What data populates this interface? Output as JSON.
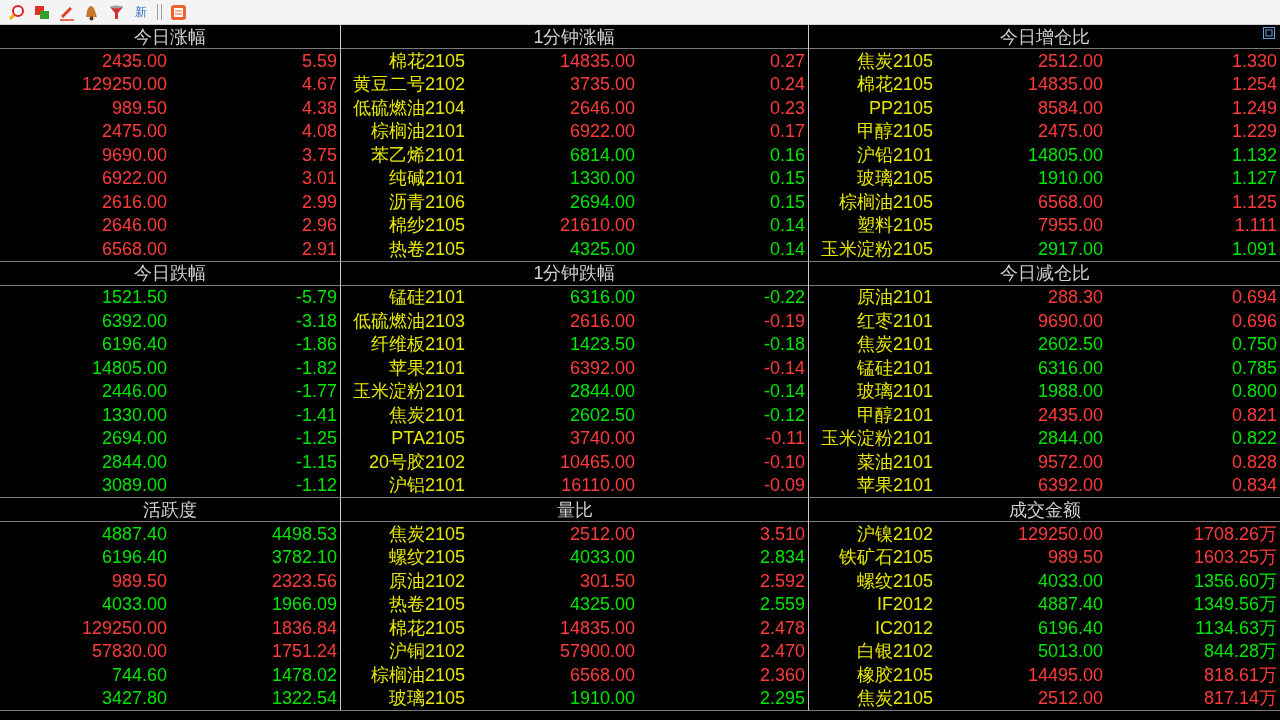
{
  "toolbar": {
    "new_label": "新"
  },
  "panels": [
    {
      "title": "今日涨幅",
      "rows": [
        {
          "price": "2435.00",
          "price_rising": true,
          "value": "5.59",
          "value_rising": true
        },
        {
          "price": "129250.00",
          "price_rising": true,
          "value": "4.67",
          "value_rising": true
        },
        {
          "price": "989.50",
          "price_rising": true,
          "value": "4.38",
          "value_rising": true
        },
        {
          "price": "2475.00",
          "price_rising": true,
          "value": "4.08",
          "value_rising": true
        },
        {
          "price": "9690.00",
          "price_rising": true,
          "value": "3.75",
          "value_rising": true
        },
        {
          "price": "6922.00",
          "price_rising": true,
          "value": "3.01",
          "value_rising": true
        },
        {
          "price": "2616.00",
          "price_rising": true,
          "value": "2.99",
          "value_rising": true
        },
        {
          "price": "2646.00",
          "price_rising": true,
          "value": "2.96",
          "value_rising": true
        },
        {
          "price": "6568.00",
          "price_rising": true,
          "value": "2.91",
          "value_rising": true
        }
      ]
    },
    {
      "title": "1分钟涨幅",
      "rows": [
        {
          "name": "棉花2105",
          "price": "14835.00",
          "price_rising": true,
          "value": "0.27",
          "value_rising": true
        },
        {
          "name": "黄豆二号2102",
          "price": "3735.00",
          "price_rising": true,
          "value": "0.24",
          "value_rising": true
        },
        {
          "name": "低硫燃油2104",
          "price": "2646.00",
          "price_rising": true,
          "value": "0.23",
          "value_rising": true
        },
        {
          "name": "棕榈油2101",
          "price": "6922.00",
          "price_rising": true,
          "value": "0.17",
          "value_rising": true
        },
        {
          "name": "苯乙烯2101",
          "price": "6814.00",
          "price_rising": false,
          "value": "0.16",
          "value_rising": false
        },
        {
          "name": "纯碱2101",
          "price": "1330.00",
          "price_rising": false,
          "value": "0.15",
          "value_rising": false
        },
        {
          "name": "沥青2106",
          "price": "2694.00",
          "price_rising": false,
          "value": "0.15",
          "value_rising": false
        },
        {
          "name": "棉纱2105",
          "price": "21610.00",
          "price_rising": true,
          "value": "0.14",
          "value_rising": false
        },
        {
          "name": "热卷2105",
          "price": "4325.00",
          "price_rising": false,
          "value": "0.14",
          "value_rising": false
        }
      ]
    },
    {
      "title": "今日增仓比",
      "rows": [
        {
          "name": "焦炭2105",
          "price": "2512.00",
          "price_rising": true,
          "value": "1.330",
          "value_rising": true
        },
        {
          "name": "棉花2105",
          "price": "14835.00",
          "price_rising": true,
          "value": "1.254",
          "value_rising": true
        },
        {
          "name": "PP2105",
          "price": "8584.00",
          "price_rising": true,
          "value": "1.249",
          "value_rising": true
        },
        {
          "name": "甲醇2105",
          "price": "2475.00",
          "price_rising": true,
          "value": "1.229",
          "value_rising": true
        },
        {
          "name": "沪铅2101",
          "price": "14805.00",
          "price_rising": false,
          "value": "1.132",
          "value_rising": false
        },
        {
          "name": "玻璃2105",
          "price": "1910.00",
          "price_rising": false,
          "value": "1.127",
          "value_rising": false
        },
        {
          "name": "棕榈油2105",
          "price": "6568.00",
          "price_rising": true,
          "value": "1.125",
          "value_rising": true
        },
        {
          "name": "塑料2105",
          "price": "7955.00",
          "price_rising": true,
          "value": "1.111",
          "value_rising": true
        },
        {
          "name": "玉米淀粉2105",
          "price": "2917.00",
          "price_rising": false,
          "value": "1.091",
          "value_rising": false
        }
      ]
    },
    {
      "title": "今日跌幅",
      "rows": [
        {
          "price": "1521.50",
          "price_rising": false,
          "value": "-5.79",
          "value_rising": false
        },
        {
          "price": "6392.00",
          "price_rising": false,
          "value": "-3.18",
          "value_rising": false
        },
        {
          "price": "6196.40",
          "price_rising": false,
          "value": "-1.86",
          "value_rising": false
        },
        {
          "price": "14805.00",
          "price_rising": false,
          "value": "-1.82",
          "value_rising": false
        },
        {
          "price": "2446.00",
          "price_rising": false,
          "value": "-1.77",
          "value_rising": false
        },
        {
          "price": "1330.00",
          "price_rising": false,
          "value": "-1.41",
          "value_rising": false
        },
        {
          "price": "2694.00",
          "price_rising": false,
          "value": "-1.25",
          "value_rising": false
        },
        {
          "price": "2844.00",
          "price_rising": false,
          "value": "-1.15",
          "value_rising": false
        },
        {
          "price": "3089.00",
          "price_rising": false,
          "value": "-1.12",
          "value_rising": false
        }
      ]
    },
    {
      "title": "1分钟跌幅",
      "rows": [
        {
          "name": "锰硅2101",
          "price": "6316.00",
          "price_rising": false,
          "value": "-0.22",
          "value_rising": false
        },
        {
          "name": "低硫燃油2103",
          "price": "2616.00",
          "price_rising": true,
          "value": "-0.19",
          "value_rising": true
        },
        {
          "name": "纤维板2101",
          "price": "1423.50",
          "price_rising": false,
          "value": "-0.18",
          "value_rising": false
        },
        {
          "name": "苹果2101",
          "price": "6392.00",
          "price_rising": true,
          "value": "-0.14",
          "value_rising": true
        },
        {
          "name": "玉米淀粉2101",
          "price": "2844.00",
          "price_rising": false,
          "value": "-0.14",
          "value_rising": false
        },
        {
          "name": "焦炭2101",
          "price": "2602.50",
          "price_rising": false,
          "value": "-0.12",
          "value_rising": false
        },
        {
          "name": "PTA2105",
          "price": "3740.00",
          "price_rising": true,
          "value": "-0.11",
          "value_rising": true
        },
        {
          "name": "20号胶2102",
          "price": "10465.00",
          "price_rising": true,
          "value": "-0.10",
          "value_rising": true
        },
        {
          "name": "沪铝2101",
          "price": "16110.00",
          "price_rising": true,
          "value": "-0.09",
          "value_rising": true
        }
      ]
    },
    {
      "title": "今日减仓比",
      "rows": [
        {
          "name": "原油2101",
          "price": "288.30",
          "price_rising": true,
          "value": "0.694",
          "value_rising": true
        },
        {
          "name": "红枣2101",
          "price": "9690.00",
          "price_rising": true,
          "value": "0.696",
          "value_rising": true
        },
        {
          "name": "焦炭2101",
          "price": "2602.50",
          "price_rising": false,
          "value": "0.750",
          "value_rising": false
        },
        {
          "name": "锰硅2101",
          "price": "6316.00",
          "price_rising": false,
          "value": "0.785",
          "value_rising": false
        },
        {
          "name": "玻璃2101",
          "price": "1988.00",
          "price_rising": false,
          "value": "0.800",
          "value_rising": false
        },
        {
          "name": "甲醇2101",
          "price": "2435.00",
          "price_rising": true,
          "value": "0.821",
          "value_rising": true
        },
        {
          "name": "玉米淀粉2101",
          "price": "2844.00",
          "price_rising": false,
          "value": "0.822",
          "value_rising": false
        },
        {
          "name": "菜油2101",
          "price": "9572.00",
          "price_rising": true,
          "value": "0.828",
          "value_rising": true
        },
        {
          "name": "苹果2101",
          "price": "6392.00",
          "price_rising": true,
          "value": "0.834",
          "value_rising": true
        }
      ]
    },
    {
      "title": "活跃度",
      "rows": [
        {
          "price": "4887.40",
          "price_rising": false,
          "value": "4498.53",
          "value_rising": false
        },
        {
          "price": "6196.40",
          "price_rising": false,
          "value": "3782.10",
          "value_rising": false
        },
        {
          "price": "989.50",
          "price_rising": true,
          "value": "2323.56",
          "value_rising": true
        },
        {
          "price": "4033.00",
          "price_rising": false,
          "value": "1966.09",
          "value_rising": false
        },
        {
          "price": "129250.00",
          "price_rising": true,
          "value": "1836.84",
          "value_rising": true
        },
        {
          "price": "57830.00",
          "price_rising": true,
          "value": "1751.24",
          "value_rising": true
        },
        {
          "price": "744.60",
          "price_rising": false,
          "value": "1478.02",
          "value_rising": false
        },
        {
          "price": "3427.80",
          "price_rising": false,
          "value": "1322.54",
          "value_rising": false
        }
      ]
    },
    {
      "title": "量比",
      "rows": [
        {
          "name": "焦炭2105",
          "price": "2512.00",
          "price_rising": true,
          "value": "3.510",
          "value_rising": true
        },
        {
          "name": "螺纹2105",
          "price": "4033.00",
          "price_rising": false,
          "value": "2.834",
          "value_rising": false
        },
        {
          "name": "原油2102",
          "price": "301.50",
          "price_rising": true,
          "value": "2.592",
          "value_rising": true
        },
        {
          "name": "热卷2105",
          "price": "4325.00",
          "price_rising": false,
          "value": "2.559",
          "value_rising": false
        },
        {
          "name": "棉花2105",
          "price": "14835.00",
          "price_rising": true,
          "value": "2.478",
          "value_rising": true
        },
        {
          "name": "沪铜2102",
          "price": "57900.00",
          "price_rising": true,
          "value": "2.470",
          "value_rising": true
        },
        {
          "name": "棕榈油2105",
          "price": "6568.00",
          "price_rising": true,
          "value": "2.360",
          "value_rising": true
        },
        {
          "name": "玻璃2105",
          "price": "1910.00",
          "price_rising": false,
          "value": "2.295",
          "value_rising": false
        }
      ]
    },
    {
      "title": "成交金额",
      "rows": [
        {
          "name": "沪镍2102",
          "price": "129250.00",
          "price_rising": true,
          "value": "1708.26万",
          "value_rising": true
        },
        {
          "name": "铁矿石2105",
          "price": "989.50",
          "price_rising": true,
          "value": "1603.25万",
          "value_rising": true
        },
        {
          "name": "螺纹2105",
          "price": "4033.00",
          "price_rising": false,
          "value": "1356.60万",
          "value_rising": false
        },
        {
          "name": "IF2012",
          "price": "4887.40",
          "price_rising": false,
          "value": "1349.56万",
          "value_rising": false
        },
        {
          "name": "IC2012",
          "price": "6196.40",
          "price_rising": false,
          "value": "1134.63万",
          "value_rising": false
        },
        {
          "name": "白银2102",
          "price": "5013.00",
          "price_rising": false,
          "value": "844.28万",
          "value_rising": false
        },
        {
          "name": "橡胶2105",
          "price": "14495.00",
          "price_rising": true,
          "value": "818.61万",
          "value_rising": true
        },
        {
          "name": "焦炭2105",
          "price": "2512.00",
          "price_rising": true,
          "value": "817.14万",
          "value_rising": true
        }
      ]
    }
  ]
}
